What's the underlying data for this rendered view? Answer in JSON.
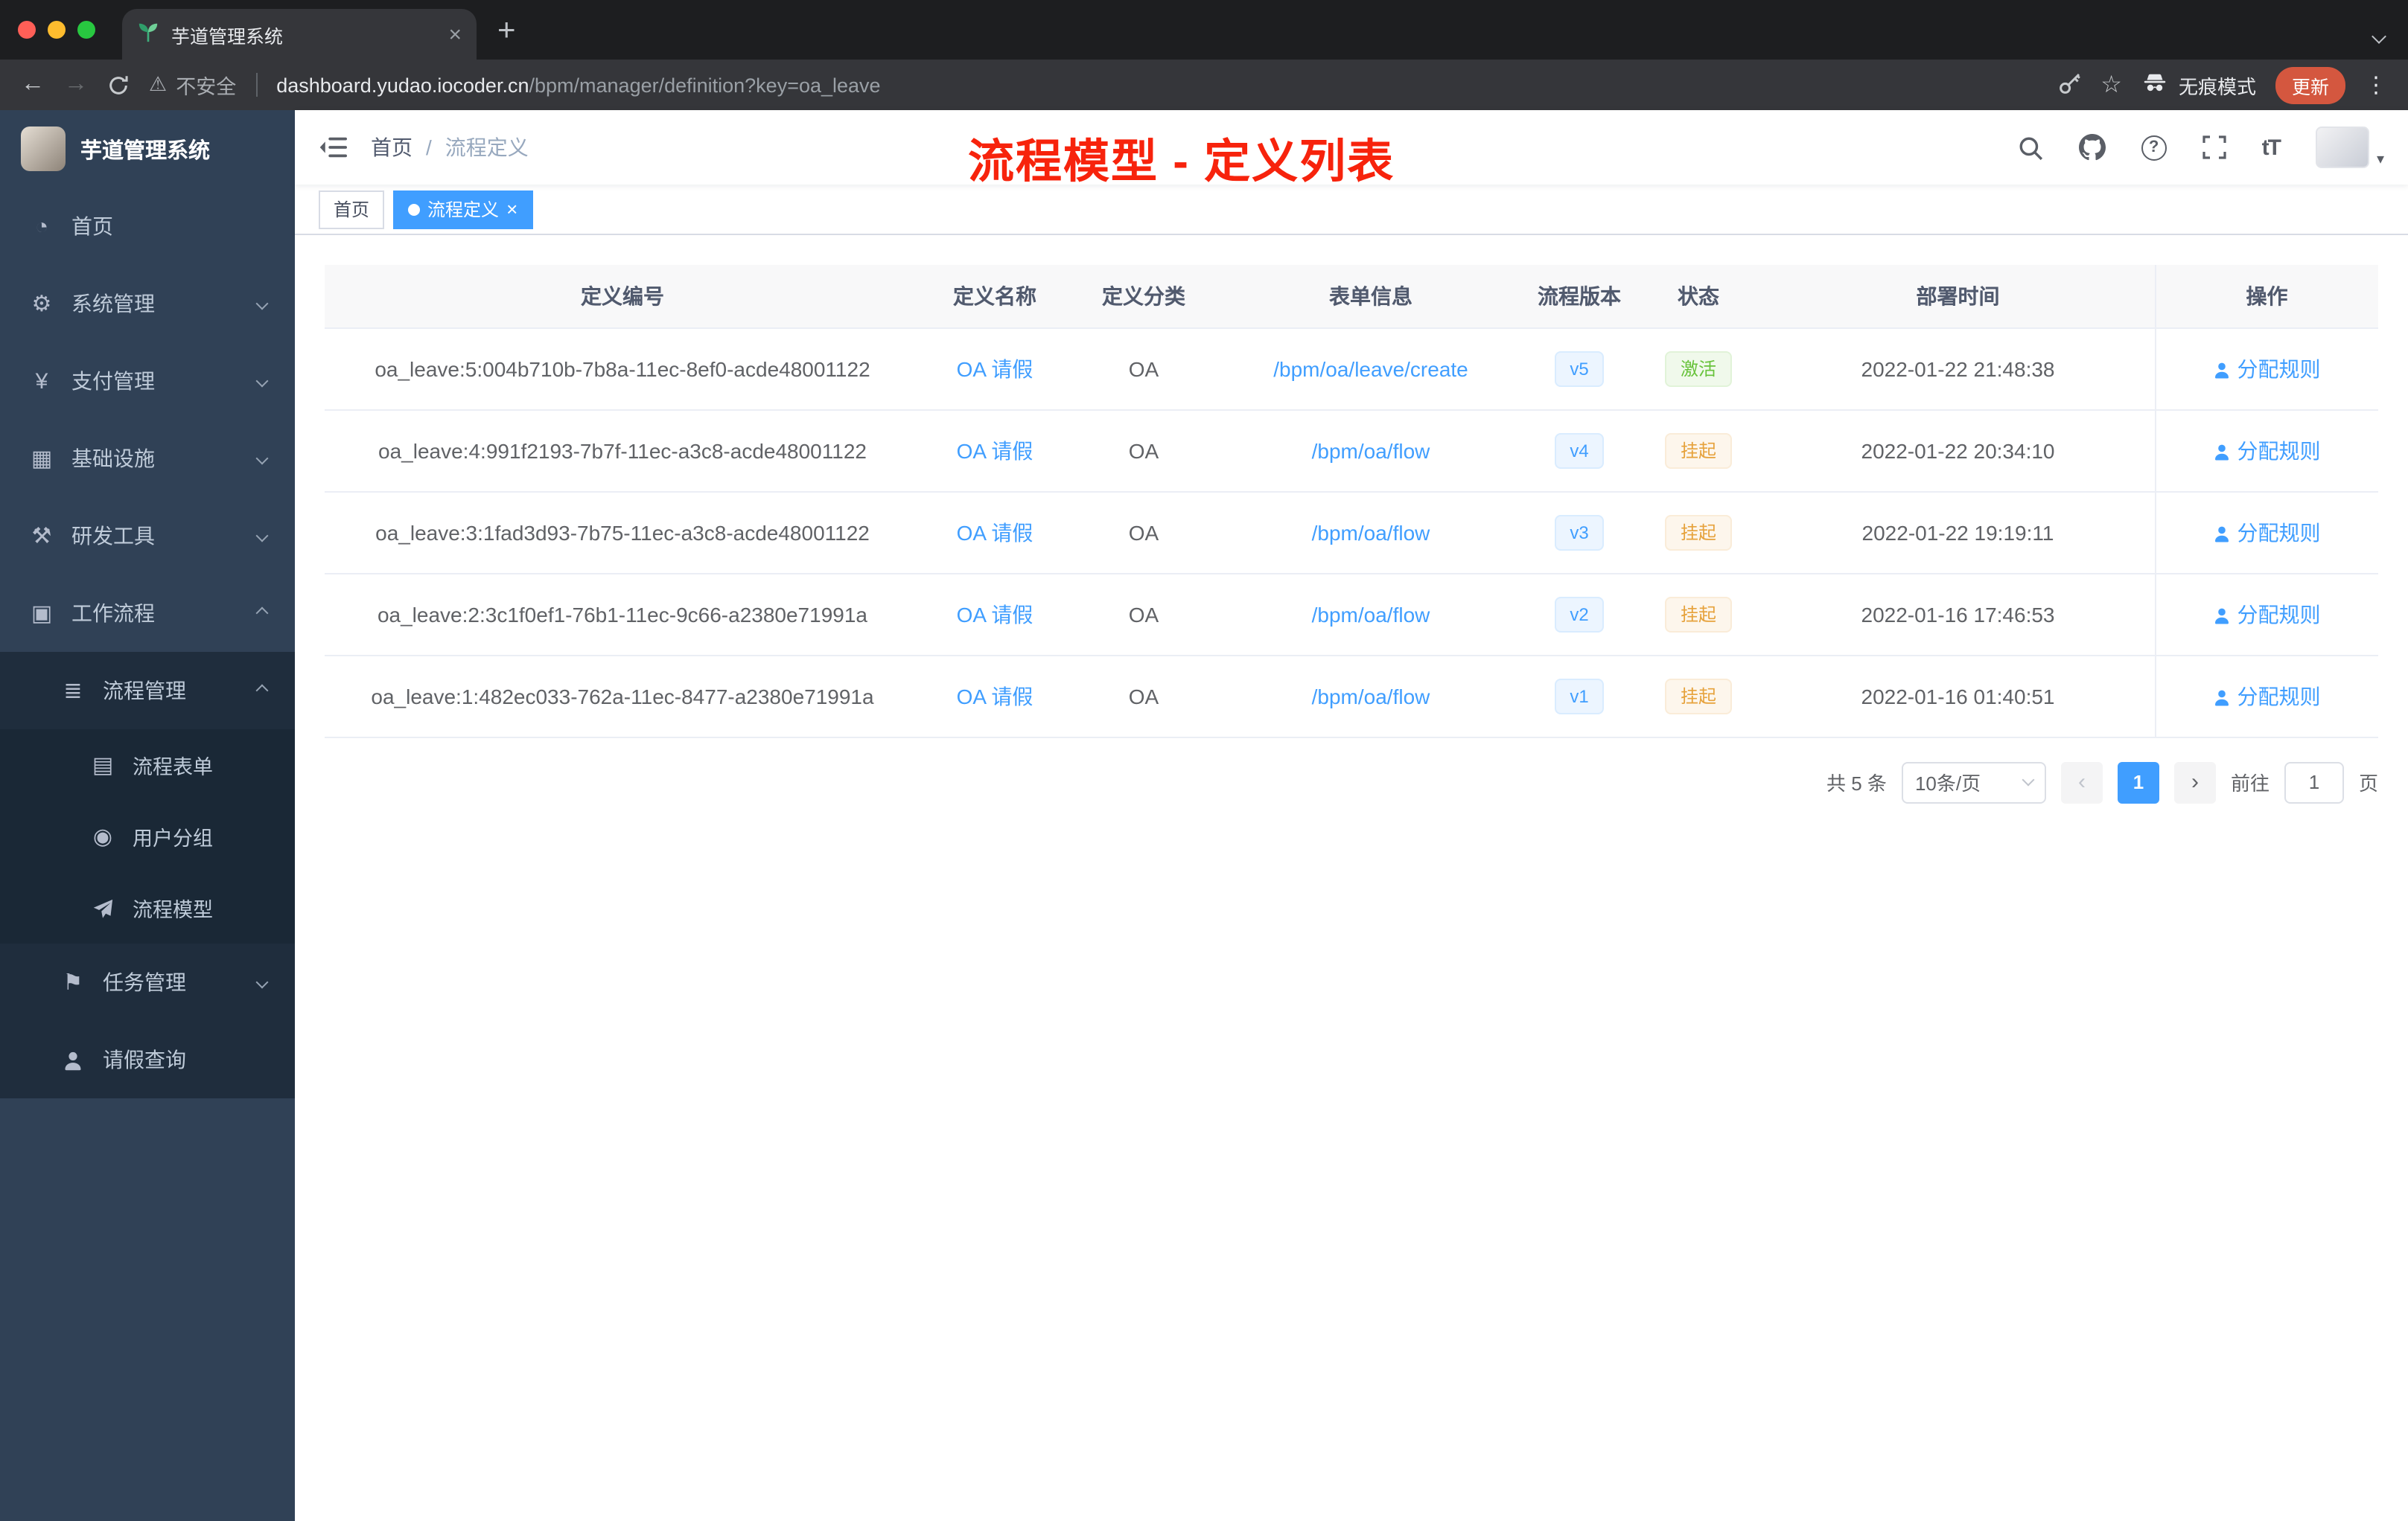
{
  "browser": {
    "tab_title": "芋道管理系统",
    "new_tab_label": "+",
    "security_label": "不安全",
    "url_domain": "dashboard.yudao.iocoder.cn",
    "url_path": "/bpm/manager/definition?key=oa_leave",
    "incognito_label": "无痕模式",
    "update_label": "更新"
  },
  "annotation": "流程模型 - 定义列表",
  "sidebar": {
    "logo_title": "芋道管理系统",
    "items": [
      {
        "label": "首页"
      },
      {
        "label": "系统管理"
      },
      {
        "label": "支付管理"
      },
      {
        "label": "基础设施"
      },
      {
        "label": "研发工具"
      },
      {
        "label": "工作流程"
      }
    ],
    "submenu": {
      "group_label": "流程管理",
      "children": [
        {
          "label": "流程表单"
        },
        {
          "label": "用户分组"
        },
        {
          "label": "流程模型"
        }
      ],
      "tasks_label": "任务管理",
      "leave_label": "请假查询"
    }
  },
  "header": {
    "breadcrumb": [
      "首页",
      "流程定义"
    ],
    "breadcrumb_separator": "/",
    "font_icon_label": "tT"
  },
  "tags": {
    "home": "首页",
    "active": "流程定义"
  },
  "table": {
    "headers": [
      "定义编号",
      "定义名称",
      "定义分类",
      "表单信息",
      "流程版本",
      "状态",
      "部署时间",
      "操作"
    ],
    "action_label": "分配规则",
    "rows": [
      {
        "id": "oa_leave:5:004b710b-7b8a-11ec-8ef0-acde48001122",
        "name": "OA 请假",
        "category": "OA",
        "form": "/bpm/oa/leave/create",
        "version": "v5",
        "status": "激活",
        "status_type": "success",
        "time": "2022-01-22 21:48:38"
      },
      {
        "id": "oa_leave:4:991f2193-7b7f-11ec-a3c8-acde48001122",
        "name": "OA 请假",
        "category": "OA",
        "form": "/bpm/oa/flow",
        "version": "v4",
        "status": "挂起",
        "status_type": "warning",
        "time": "2022-01-22 20:34:10"
      },
      {
        "id": "oa_leave:3:1fad3d93-7b75-11ec-a3c8-acde48001122",
        "name": "OA 请假",
        "category": "OA",
        "form": "/bpm/oa/flow",
        "version": "v3",
        "status": "挂起",
        "status_type": "warning",
        "time": "2022-01-22 19:19:11"
      },
      {
        "id": "oa_leave:2:3c1f0ef1-76b1-11ec-9c66-a2380e71991a",
        "name": "OA 请假",
        "category": "OA",
        "form": "/bpm/oa/flow",
        "version": "v2",
        "status": "挂起",
        "status_type": "warning",
        "time": "2022-01-16 17:46:53"
      },
      {
        "id": "oa_leave:1:482ec033-762a-11ec-8477-a2380e71991a",
        "name": "OA 请假",
        "category": "OA",
        "form": "/bpm/oa/flow",
        "version": "v1",
        "status": "挂起",
        "status_type": "warning",
        "time": "2022-01-16 01:40:51"
      }
    ]
  },
  "pagination": {
    "total": "共 5 条",
    "page_size": "10条/页",
    "current_page": "1",
    "goto_label": "前往",
    "goto_value": "1",
    "page_label": "页"
  },
  "colors": {
    "accent": "#409eff",
    "success": "#67c23a",
    "warning": "#e6a23c",
    "sidebar_bg": "#304156",
    "submenu_bg": "#1f2d3d",
    "annotation_red": "#f7230c"
  }
}
